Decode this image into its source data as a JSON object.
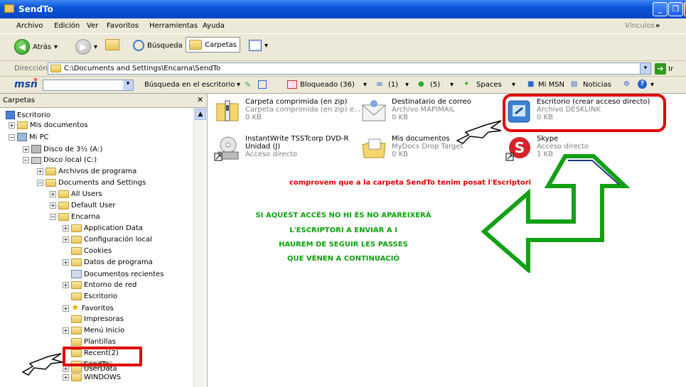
{
  "window": {
    "title": "SendTo"
  },
  "menu": [
    "Archivo",
    "Edición",
    "Ver",
    "Favoritos",
    "Herramientas",
    "Ayuda"
  ],
  "menu_links": "Vínculos",
  "toolbar": {
    "back": "Atrás",
    "search": "Búsqueda",
    "folders": "Carpetas"
  },
  "address": {
    "label": "Dirección",
    "path": "C:\\Documents and Settings\\Encarna\\SendTo",
    "go": "Ir"
  },
  "msn": {
    "logo": "msn",
    "search": "Búsqueda en el escritorio",
    "blocked": "Bloqueado (36)",
    "mail": "(1)",
    "people": "(5)",
    "spaces": "Spaces",
    "mimsn": "Mi MSN",
    "news": "Noticias"
  },
  "folders_panel": {
    "title": "Carpetas"
  },
  "tree": [
    {
      "label": "Escritorio"
    },
    {
      "label": "Mis documentos"
    },
    {
      "label": "Mi PC"
    },
    {
      "label": "Disco de 3½ (A:)"
    },
    {
      "label": "Disco local (C:)"
    },
    {
      "label": "Archivos de programa"
    },
    {
      "label": "Documents and Settings"
    },
    {
      "label": "All Users"
    },
    {
      "label": "Default User"
    },
    {
      "label": "Encarna"
    },
    {
      "label": "Application Data"
    },
    {
      "label": "Configuración local"
    },
    {
      "label": "Cookies"
    },
    {
      "label": "Datos de programa"
    },
    {
      "label": "Documentos recientes"
    },
    {
      "label": "Entorno de red"
    },
    {
      "label": "Escritorio"
    },
    {
      "label": "Favoritos"
    },
    {
      "label": "Impresoras"
    },
    {
      "label": "Menú Inicio"
    },
    {
      "label": "Plantillas"
    },
    {
      "label": "Recent(2)"
    },
    {
      "label": "SendTo"
    },
    {
      "label": "UserData"
    },
    {
      "label": "WINDOWS"
    }
  ],
  "items": [
    {
      "name": "Carpeta comprimida (en zip)",
      "type": "Carpeta comprimida (en zip) e...",
      "size": "0 KB"
    },
    {
      "name": "Destinatario de correo",
      "type": "Archivo MAPIMAIL",
      "size": "0 KB"
    },
    {
      "name": "Escritorio (crear acceso directo)",
      "type": "Archivo DESKLINK",
      "size": "0 KB"
    },
    {
      "name": "InstantWrite TSSTcorp DVD-R Unidad (J)",
      "type": "Acceso directo",
      "size": ""
    },
    {
      "name": "Mis documentos",
      "type": "MyDocs Drop Target",
      "size": "0 KB"
    },
    {
      "name": "Skype",
      "type": "Acceso directo",
      "size": "1 KB"
    }
  ],
  "annotations": {
    "red": "comprovem que a la carpeta SendTo tenim posat l'Escriptori",
    "green": [
      "SI AQUEST ACCÉS NO HI ÉS NO APAREIXERÀ",
      "L'ESCRIPTORI A ENVIAR A I",
      "HAUREM DE SEGUIR LES PASSES",
      "QUE VÉNEN A CONTINUACIÓ"
    ]
  },
  "colors": {
    "annotation_red": "#e00000",
    "annotation_green": "#10a010",
    "highlight_box": "#e00000"
  }
}
